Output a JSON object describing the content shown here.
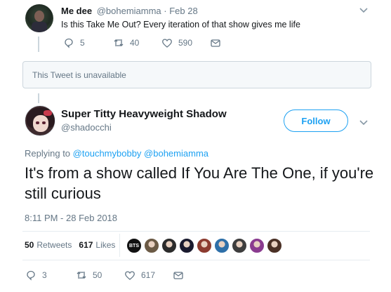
{
  "parent_tweet": {
    "name": "Me dee",
    "handle_date": "@bohemiamma · Feb 28",
    "text": "Is this Take Me Out? Every iteration of that show gives me life",
    "replies": "5",
    "retweets": "40",
    "likes": "590"
  },
  "unavailable_notice": "This Tweet is unavailable",
  "main_tweet": {
    "name": "Super Titty Heavyweight Shadow",
    "handle": "@shadocchi",
    "follow_label": "Follow",
    "replying_prefix": "Replying to",
    "mention_1": "@touchmybobby",
    "mention_2": "@bohemiamma",
    "text": "It's from a show called If You Are The One, if you're still curious",
    "timestamp": "8:11 PM - 28 Feb 2018",
    "retweets_count": "50",
    "retweets_label": "Retweets",
    "likes_count": "617",
    "likes_label": "Likes",
    "liker_badge_text": "BTS",
    "action_replies": "3",
    "action_retweets": "50",
    "action_likes": "617"
  },
  "colors": {
    "accent": "#1da1f2",
    "muted": "#657786",
    "text": "#14171a",
    "border": "#e6ecf0"
  },
  "liker_avatar_colors": [
    "#111111",
    "#6b5a45",
    "#2b2b2b",
    "#1a1a2e",
    "#8c3b2f",
    "#2e6fa8",
    "#3d3d3d",
    "#8a3b8f",
    "#4a3025"
  ]
}
